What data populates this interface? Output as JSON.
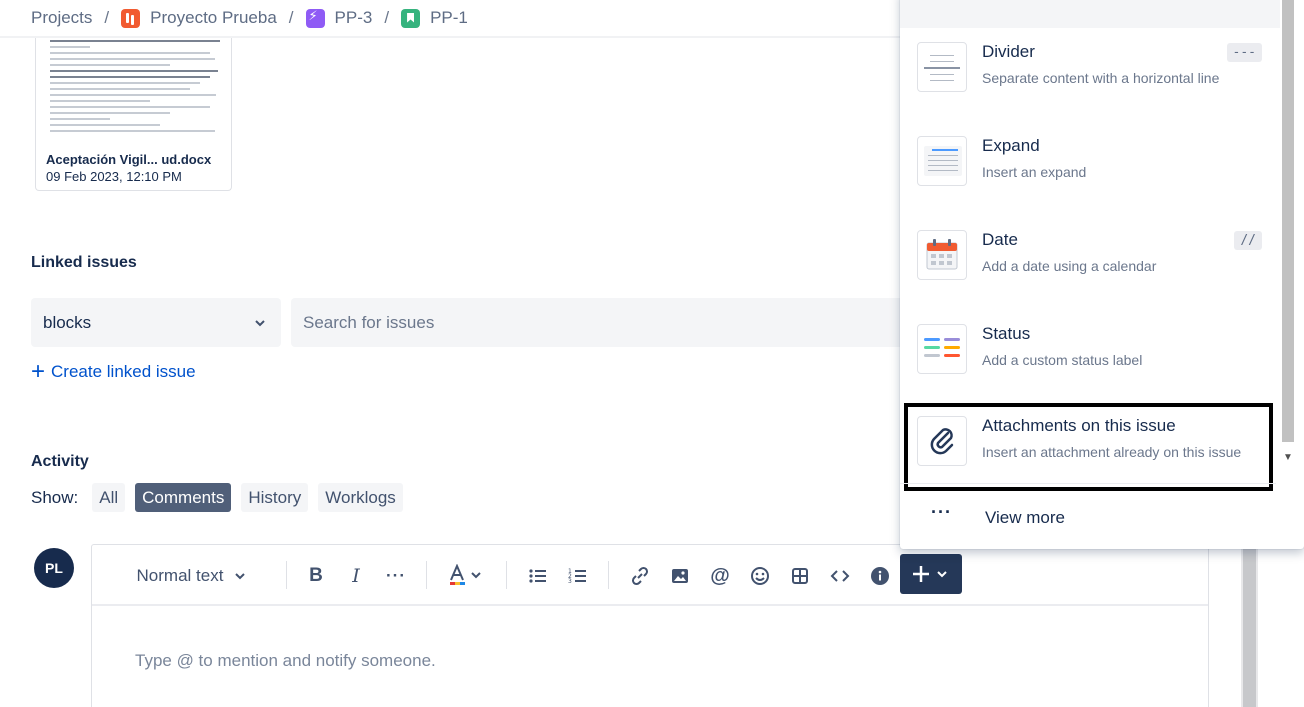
{
  "breadcrumb": {
    "items": [
      {
        "label": "Projects",
        "icon": null
      },
      {
        "label": "Proyecto Prueba",
        "icon": "project-icon"
      },
      {
        "label": "PP-3",
        "icon": "epic-icon"
      },
      {
        "label": "PP-1",
        "icon": "story-icon"
      }
    ],
    "separator": "/"
  },
  "attachment": {
    "name": "Aceptación Vigil... ud.docx",
    "date": "09 Feb 2023, 12:10 PM"
  },
  "linked_issues": {
    "title": "Linked issues",
    "relation_value": "blocks",
    "search_placeholder": "Search for issues",
    "create_label": "Create linked issue"
  },
  "activity": {
    "title": "Activity",
    "show_label": "Show:",
    "filters": [
      {
        "label": "All",
        "active": false
      },
      {
        "label": "Comments",
        "active": true
      },
      {
        "label": "History",
        "active": false
      },
      {
        "label": "Worklogs",
        "active": false
      }
    ]
  },
  "user": {
    "initials": "PL"
  },
  "editor": {
    "text_style": "Normal text",
    "placeholder": "Type @ to mention and notify someone.",
    "toolbar_icons": [
      "bold-icon",
      "italic-icon",
      "more-formatting-icon",
      "text-color-icon",
      "bullet-list-icon",
      "numbered-list-icon",
      "link-icon",
      "image-icon",
      "mention-icon",
      "emoji-icon",
      "table-icon",
      "code-icon",
      "info-icon",
      "insert-plus-icon"
    ]
  },
  "insert_menu": {
    "items": [
      {
        "title": "Divider",
        "description": "Separate content with a horizontal line",
        "shortcut": "---",
        "icon": "divider-icon"
      },
      {
        "title": "Expand",
        "description": "Insert an expand",
        "shortcut": "",
        "icon": "expand-icon"
      },
      {
        "title": "Date",
        "description": "Add a date using a calendar",
        "shortcut": "//",
        "icon": "date-icon"
      },
      {
        "title": "Status",
        "description": "Add a custom status label",
        "shortcut": "",
        "icon": "status-icon"
      },
      {
        "title": "Attachments on this issue",
        "description": "Insert an attachment already on this issue",
        "shortcut": "",
        "icon": "paperclip-icon"
      }
    ],
    "view_more": "View more"
  },
  "colors": {
    "primary_dark": "#253858",
    "link": "#0052cc",
    "active_pill": "#505f79",
    "text": "#172b4d",
    "muted": "#6b778c"
  }
}
